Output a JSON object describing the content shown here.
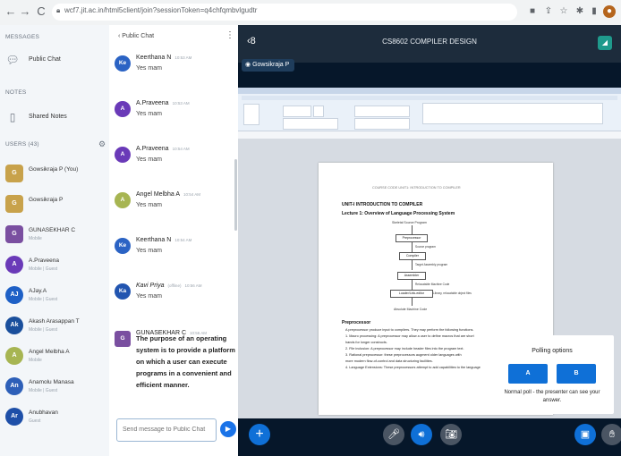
{
  "browser": {
    "url": "wcf7.jit.ac.in/html5client/join?sessionToken=q4chfqmbvlgudtr"
  },
  "sidebar": {
    "messages_header": "MESSAGES",
    "public_chat_label": "Public Chat",
    "notes_header": "NOTES",
    "shared_notes_label": "Shared Notes",
    "users_header": "USERS (43)",
    "users": [
      {
        "name": "Gowsikraja P (You)",
        "status": "",
        "initials": "G",
        "color": "#c8a24b"
      },
      {
        "name": "Gowsikraja P",
        "status": "",
        "initials": "G",
        "color": "#c8a24b"
      },
      {
        "name": "GUNASEKHAR C",
        "status": "Mobile",
        "initials": "G",
        "color": "#7a4fa0"
      },
      {
        "name": "A.Praveena",
        "status": "Mobile | Guest",
        "initials": "A",
        "color": "#6a3ab8"
      },
      {
        "name": "AJay.A",
        "status": "Mobile | Guest",
        "initials": "AJ",
        "color": "#1e60c6"
      },
      {
        "name": "Akash Arasappan T",
        "status": "Mobile | Guest",
        "initials": "Ak",
        "color": "#1a4f9c"
      },
      {
        "name": "Angel Melbha A",
        "status": "Mobile",
        "initials": "A",
        "color": "#a7b552"
      },
      {
        "name": "Anamolu Manasa",
        "status": "Mobile | Guest",
        "initials": "An",
        "color": "#2d5fb8"
      },
      {
        "name": "Anubhavan",
        "status": "Guest",
        "initials": "Ar",
        "color": "#1e4fa8"
      }
    ]
  },
  "chat": {
    "title": "Public Chat",
    "input_placeholder": "Send message to Public Chat",
    "messages": [
      {
        "name": "Keerthana N",
        "time": "10:53 AM",
        "text": "Yes mam",
        "initials": "Ke",
        "color": "#2b63c4"
      },
      {
        "name": "A.Praveena",
        "time": "10:53 AM",
        "text": "Yes mam",
        "initials": "A",
        "color": "#6a3ab8"
      },
      {
        "name": "A.Praveena",
        "time": "10:54 AM",
        "text": "Yes mam",
        "initials": "A",
        "color": "#6a3ab8"
      },
      {
        "name": "Angel Melbha A",
        "time": "10:54 AM",
        "text": "Yes mam",
        "initials": "A",
        "color": "#a7b552"
      },
      {
        "name": "Keerthana N",
        "time": "10:54 AM",
        "text": "Yes mam",
        "initials": "Ke",
        "color": "#2b63c4"
      },
      {
        "name": "Kavi Priya",
        "offline": "(offline)",
        "time": "10:56 AM",
        "text": "Yes mam",
        "initials": "Ka",
        "color": "#2255b0"
      }
    ],
    "last_message": {
      "name": "GUNASEKHAR C",
      "time": "10:56 AM",
      "text": "The purpose of an operating system is to provide a platform on which a user can execute programs in a convenient and efficient manner."
    }
  },
  "presentation": {
    "title": "CS8602 COMPILER DESIGN",
    "presenter": "Gowsikraja P",
    "document": {
      "header_line": "COURSE CODE  UNIT1: INTRODUCTION TO COMPILER",
      "unit_title": "UNIT-I INTRODUCTION TO COMPILER",
      "lecture_title": "Lecture 1: Overview of Language Processing System",
      "flow_top": "Skeletal Source Program",
      "flow_items": [
        "Preprocessor",
        "Compiler",
        "Assembler",
        "Loader/Link-editor"
      ],
      "flow_labels": [
        "Source program",
        "Target Assembly program",
        "Relocatable Machine Code",
        "Library, relocatable object files"
      ],
      "flow_bottom": "Absolute Machine Code",
      "section": "Preprocessor",
      "body_lines": [
        "A preprocessor produce input to compilers. They may perform the following functions.",
        "1. Macro processing: A preprocessor may allow a user to define macros that are short",
        "   hands for longer constructs.",
        "2. File inclusion: A preprocessor may include header files into the program text.",
        "3. Rational preprocessor: these preprocessors augment older languages with",
        "   more modern flow-of-control and data structuring facilities.",
        "4. Language Extensions: These preprocessors attempt to add capabilities to the language"
      ]
    }
  },
  "polling": {
    "title": "Polling options",
    "option_a": "A",
    "option_b": "B",
    "note": "Normal poll - the presenter can see your answer."
  }
}
